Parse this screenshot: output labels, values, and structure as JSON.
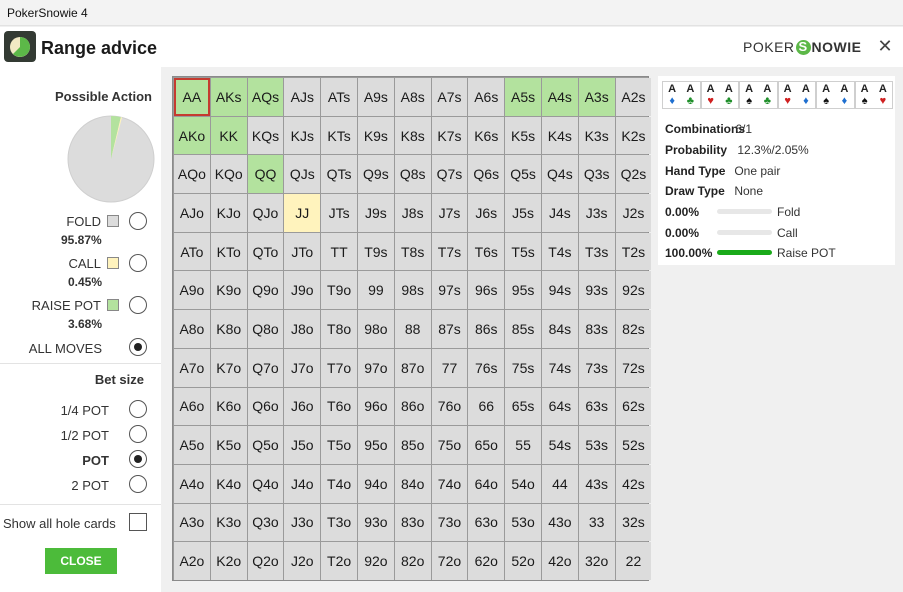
{
  "window": {
    "title": "PokerSnowie 4"
  },
  "header": {
    "title": "Range advice",
    "brand_left": "POKER",
    "brand_right": "NOWIE",
    "icon": "pie-chart-app-icon",
    "close_icon": "close-icon"
  },
  "possible_action": {
    "title": "Possible Action",
    "pie": {
      "fold": 95.87,
      "call": 0.45,
      "raise": 3.68
    },
    "options": [
      {
        "label": "FOLD",
        "pct": "95.87%",
        "color": "#dcdcdc"
      },
      {
        "label": "CALL",
        "pct": "0.45%",
        "color": "#fff3bd"
      },
      {
        "label": "RAISE POT",
        "pct": "3.68%",
        "color": "#b3e29e"
      }
    ],
    "all_moves": "ALL MOVES"
  },
  "bet_size": {
    "title": "Bet size",
    "options": [
      "1/4 POT",
      "1/2 POT",
      "POT",
      "2 POT"
    ],
    "selected": "POT"
  },
  "show_all": "Show all hole cards",
  "close_button": "CLOSE",
  "grid": {
    "rows": [
      [
        "AA",
        "AKs",
        "AQs",
        "AJs",
        "ATs",
        "A9s",
        "A8s",
        "A7s",
        "A6s",
        "A5s",
        "A4s",
        "A3s",
        "A2s"
      ],
      [
        "AKo",
        "KK",
        "KQs",
        "KJs",
        "KTs",
        "K9s",
        "K8s",
        "K7s",
        "K6s",
        "K5s",
        "K4s",
        "K3s",
        "K2s"
      ],
      [
        "AQo",
        "KQo",
        "QQ",
        "QJs",
        "QTs",
        "Q9s",
        "Q8s",
        "Q7s",
        "Q6s",
        "Q5s",
        "Q4s",
        "Q3s",
        "Q2s"
      ],
      [
        "AJo",
        "KJo",
        "QJo",
        "JJ",
        "JTs",
        "J9s",
        "J8s",
        "J7s",
        "J6s",
        "J5s",
        "J4s",
        "J3s",
        "J2s"
      ],
      [
        "ATo",
        "KTo",
        "QTo",
        "JTo",
        "TT",
        "T9s",
        "T8s",
        "T7s",
        "T6s",
        "T5s",
        "T4s",
        "T3s",
        "T2s"
      ],
      [
        "A9o",
        "K9o",
        "Q9o",
        "J9o",
        "T9o",
        "99",
        "98s",
        "97s",
        "96s",
        "95s",
        "94s",
        "93s",
        "92s"
      ],
      [
        "A8o",
        "K8o",
        "Q8o",
        "J8o",
        "T8o",
        "98o",
        "88",
        "87s",
        "86s",
        "85s",
        "84s",
        "83s",
        "82s"
      ],
      [
        "A7o",
        "K7o",
        "Q7o",
        "J7o",
        "T7o",
        "97o",
        "87o",
        "77",
        "76s",
        "75s",
        "74s",
        "73s",
        "72s"
      ],
      [
        "A6o",
        "K6o",
        "Q6o",
        "J6o",
        "T6o",
        "96o",
        "86o",
        "76o",
        "66",
        "65s",
        "64s",
        "63s",
        "62s"
      ],
      [
        "A5o",
        "K5o",
        "Q5o",
        "J5o",
        "T5o",
        "95o",
        "85o",
        "75o",
        "65o",
        "55",
        "54s",
        "53s",
        "52s"
      ],
      [
        "A4o",
        "K4o",
        "Q4o",
        "J4o",
        "T4o",
        "94o",
        "84o",
        "74o",
        "64o",
        "54o",
        "44",
        "43s",
        "42s"
      ],
      [
        "A3o",
        "K3o",
        "Q3o",
        "J3o",
        "T3o",
        "93o",
        "83o",
        "73o",
        "63o",
        "53o",
        "43o",
        "33",
        "32s"
      ],
      [
        "A2o",
        "K2o",
        "Q2o",
        "J2o",
        "T2o",
        "92o",
        "82o",
        "72o",
        "62o",
        "52o",
        "42o",
        "32o",
        "22"
      ]
    ],
    "raise": [
      "AA",
      "AKs",
      "AQs",
      "A5s",
      "A4s",
      "A3s",
      "AKo",
      "KK",
      "QQ"
    ],
    "call": [
      "JJ"
    ],
    "selected": "AA"
  },
  "details": {
    "combos": [
      [
        {
          "r": "A",
          "s": "♦",
          "c": "#1e6fd0"
        },
        {
          "r": "A",
          "s": "♣",
          "c": "#1f8f2a"
        }
      ],
      [
        {
          "r": "A",
          "s": "♥",
          "c": "#d02020"
        },
        {
          "r": "A",
          "s": "♣",
          "c": "#1f8f2a"
        }
      ],
      [
        {
          "r": "A",
          "s": "♠",
          "c": "#111111"
        },
        {
          "r": "A",
          "s": "♣",
          "c": "#1f8f2a"
        }
      ],
      [
        {
          "r": "A",
          "s": "♥",
          "c": "#d02020"
        },
        {
          "r": "A",
          "s": "♦",
          "c": "#1e6fd0"
        }
      ],
      [
        {
          "r": "A",
          "s": "♠",
          "c": "#111111"
        },
        {
          "r": "A",
          "s": "♦",
          "c": "#1e6fd0"
        }
      ],
      [
        {
          "r": "A",
          "s": "♠",
          "c": "#111111"
        },
        {
          "r": "A",
          "s": "♥",
          "c": "#d02020"
        }
      ]
    ],
    "combinations_label": "Combinations",
    "combinations_value": "6/1",
    "probability_label": "Probability",
    "probability_value": "12.3%/2.05%",
    "hand_type_label": "Hand Type",
    "hand_type_value": "One pair",
    "draw_type_label": "Draw Type",
    "draw_type_value": "None",
    "actions": [
      {
        "pct": "0.00%",
        "value": 0,
        "label": "Fold"
      },
      {
        "pct": "0.00%",
        "value": 0,
        "label": "Call"
      },
      {
        "pct": "100.00%",
        "value": 100,
        "label": "Raise POT"
      }
    ]
  }
}
